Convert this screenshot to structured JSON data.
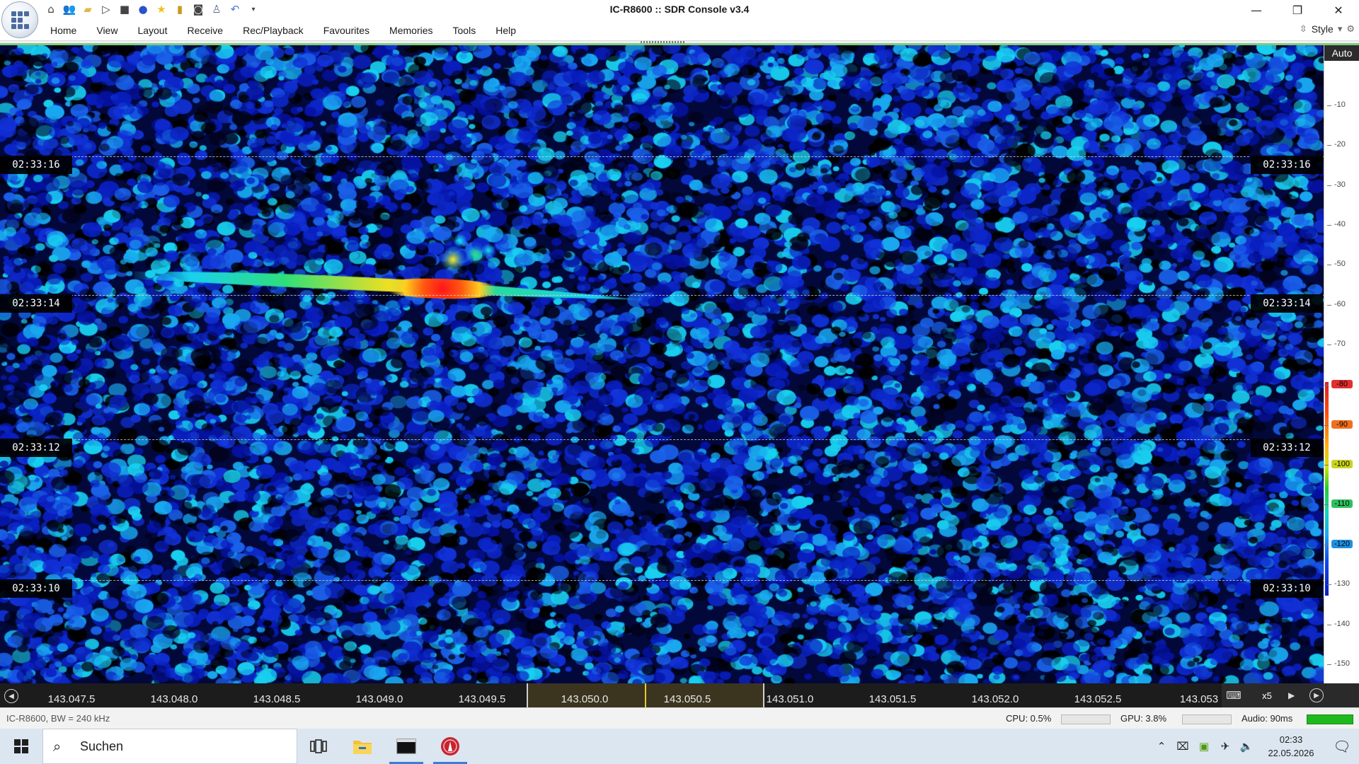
{
  "window": {
    "title": "IC-R8600 :: SDR Console v3.4",
    "minimize_icon": "minimize-icon",
    "restore_icon": "restore-icon",
    "close_icon": "close-icon"
  },
  "quick_access": [
    "home-icon",
    "users-icon",
    "folder-icon",
    "play-icon",
    "stop-icon",
    "record-icon",
    "favourite-star-icon",
    "lock-icon",
    "camera-icon",
    "antenna-icon",
    "undo-icon",
    "customize-arrow-icon"
  ],
  "menu": {
    "items": [
      "Home",
      "View",
      "Layout",
      "Receive",
      "Rec/Playback",
      "Favourites",
      "Memories",
      "Tools",
      "Help"
    ],
    "style_label": "Style"
  },
  "waterfall": {
    "timestamps": [
      "02:33:16",
      "02:33:14",
      "02:33:12",
      "02:33:10"
    ],
    "colors": {
      "background": "#03083a",
      "noise_low": "#0a1fc0",
      "noise_high": "#19d0f0",
      "signal_peak": "#e81818"
    }
  },
  "db_scale": {
    "mode": "Auto",
    "ticks": [
      "-10",
      "-20",
      "-30",
      "-40",
      "-50",
      "-60",
      "-70",
      "-80",
      "-90",
      "-100",
      "-110",
      "-120",
      "-130",
      "-140",
      "-150"
    ],
    "highlighted": [
      "-80",
      "-90",
      "-100",
      "-110",
      "-120",
      "-130"
    ]
  },
  "frequency_axis": {
    "labels": [
      "143.047.5",
      "143.048.0",
      "143.048.5",
      "143.049.0",
      "143.049.5",
      "143.050.0",
      "143.050.5",
      "143.051.0",
      "143.051.5",
      "143.052.0",
      "143.052.5",
      "143.053"
    ],
    "zoom": "x5",
    "accent_color": "#e7cb2b"
  },
  "status": {
    "device": "IC-R8600, BW = 240 kHz",
    "cpu": "CPU: 0.5%",
    "gpu": "GPU: 3.8%",
    "audio": "Audio: 90ms",
    "audio_level_color": "#1fb81f"
  },
  "taskbar": {
    "search_placeholder": "Suchen",
    "time": "02:33",
    "date": "22.05.2026",
    "apps": [
      "task-view-icon",
      "file-explorer-icon",
      "terminal-icon",
      "sdr-console-icon"
    ],
    "tray": [
      "chevron-up-icon",
      "network-icon",
      "nvidia-icon",
      "airplane-icon",
      "volume-icon"
    ]
  }
}
